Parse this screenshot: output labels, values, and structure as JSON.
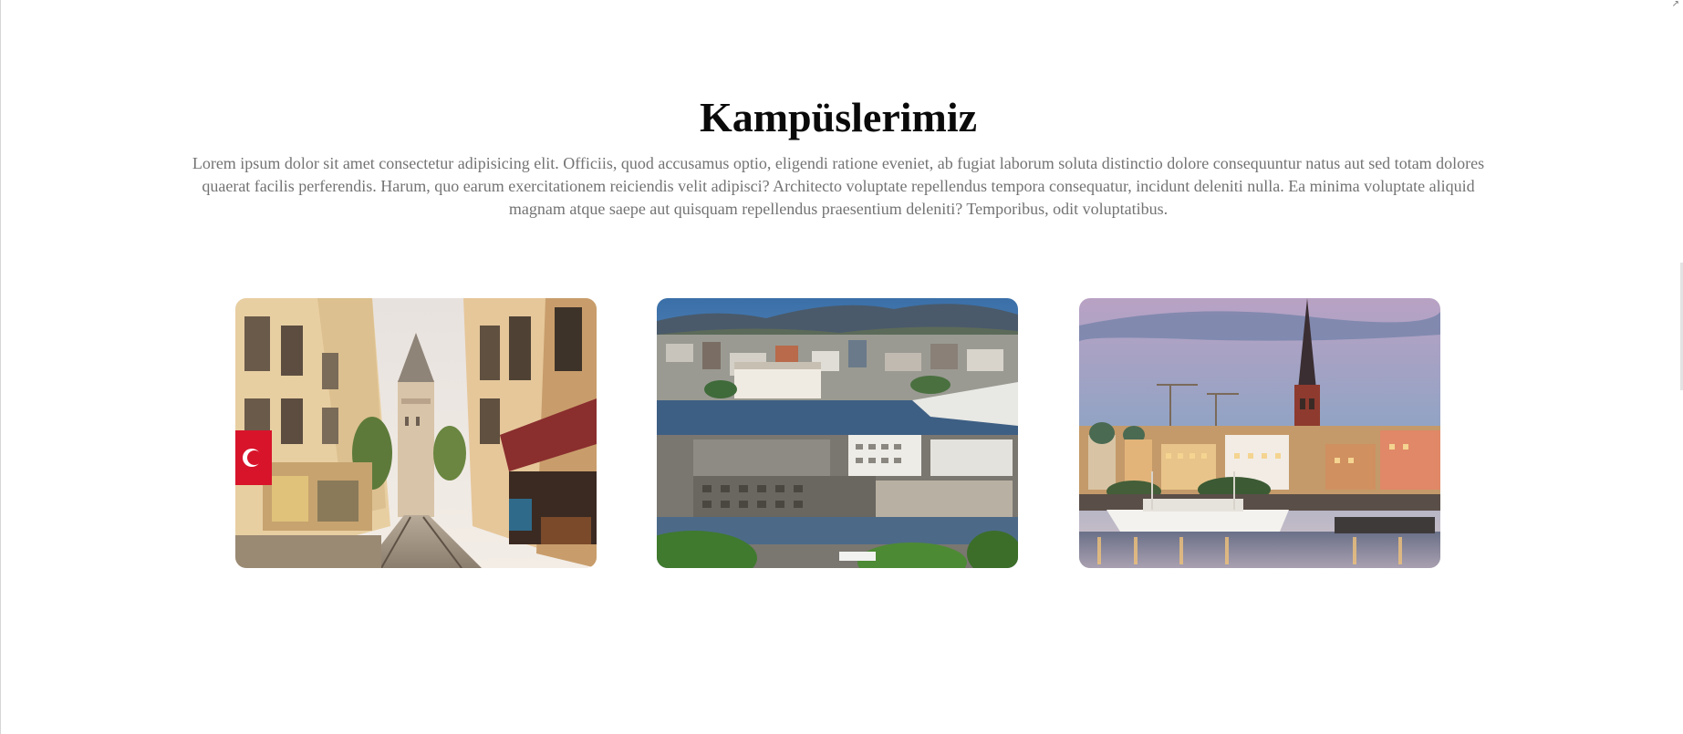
{
  "campuses": {
    "title": "Kampüslerimiz",
    "description": "Lorem ipsum dolor sit amet consectetur adipisicing elit. Officiis, quod accusamus optio, eligendi ratione eveniet, ab fugiat laborum soluta distinctio dolore consequuntur natus aut sed totam dolores quaerat facilis perferendis. Harum, quo earum exercitationem reiciendis velit adipisci? Architecto voluptate repellendus tempora consequatur, incidunt deleniti nulla. Ea minima voluptate aliquid magnam atque saepe aut quisquam repellendus praesentium deleniti? Temporibus, odit voluptatibus.",
    "cards": [
      {
        "image": "istanbul-galata-street-photo"
      },
      {
        "image": "oslo-harbor-aerial-photo"
      },
      {
        "image": "stockholm-riddarholmen-dusk-photo"
      }
    ]
  },
  "colors": {
    "title": "#0a0a0a",
    "description": "#737373",
    "background": "#ffffff"
  }
}
